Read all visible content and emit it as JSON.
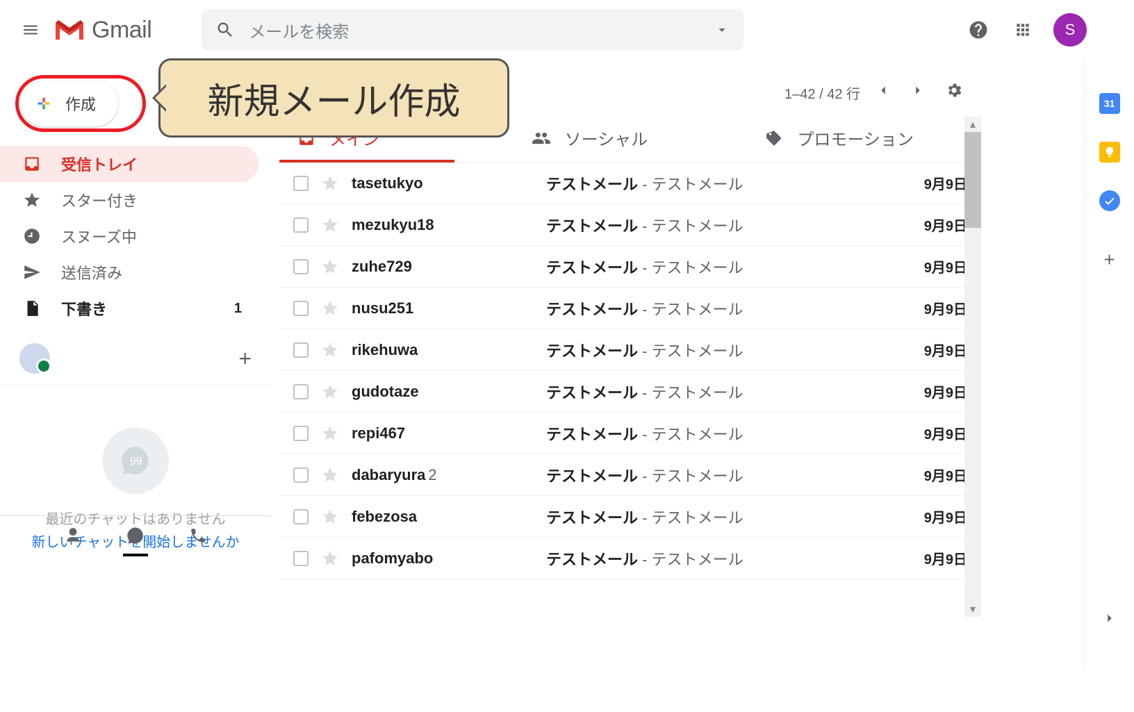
{
  "header": {
    "app_name": "Gmail",
    "search_placeholder": "メールを検索",
    "avatar_initial": "S"
  },
  "compose": {
    "label": "作成"
  },
  "annotation": {
    "text": "新規メール作成"
  },
  "nav": {
    "inbox": "受信トレイ",
    "starred": "スター付き",
    "snoozed": "スヌーズ中",
    "sent": "送信済み",
    "drafts": "下書き",
    "drafts_count": "1"
  },
  "hangouts": {
    "line1": "最近のチャットはありません",
    "line2": "新しいチャットを開始しませんか"
  },
  "toolbar": {
    "page_info": "1–42 / 42 行"
  },
  "tabs": {
    "main": "メイン",
    "social": "ソーシャル",
    "promo": "プロモーション"
  },
  "mails": [
    {
      "sender": "tasetukyo",
      "count": "",
      "subject": "テストメール",
      "snippet": "テストメール",
      "date": "9月9日"
    },
    {
      "sender": "mezukyu18",
      "count": "",
      "subject": "テストメール",
      "snippet": "テストメール",
      "date": "9月9日"
    },
    {
      "sender": "zuhe729",
      "count": "",
      "subject": "テストメール",
      "snippet": "テストメール",
      "date": "9月9日"
    },
    {
      "sender": "nusu251",
      "count": "",
      "subject": "テストメール",
      "snippet": "テストメール",
      "date": "9月9日"
    },
    {
      "sender": "rikehuwa",
      "count": "",
      "subject": "テストメール",
      "snippet": "テストメール",
      "date": "9月9日"
    },
    {
      "sender": "gudotaze",
      "count": "",
      "subject": "テストメール",
      "snippet": "テストメール",
      "date": "9月9日"
    },
    {
      "sender": "repi467",
      "count": "",
      "subject": "テストメール",
      "snippet": "テストメール",
      "date": "9月9日"
    },
    {
      "sender": "dabaryura",
      "count": "2",
      "subject": "テストメール",
      "snippet": "テストメール",
      "date": "9月9日"
    },
    {
      "sender": "febezosa",
      "count": "",
      "subject": "テストメール",
      "snippet": "テストメール",
      "date": "9月9日"
    },
    {
      "sender": "pafomyabo",
      "count": "",
      "subject": "テストメール",
      "snippet": "テストメール",
      "date": "9月9日"
    }
  ],
  "sidepanel": {
    "calendar_day": "31"
  }
}
